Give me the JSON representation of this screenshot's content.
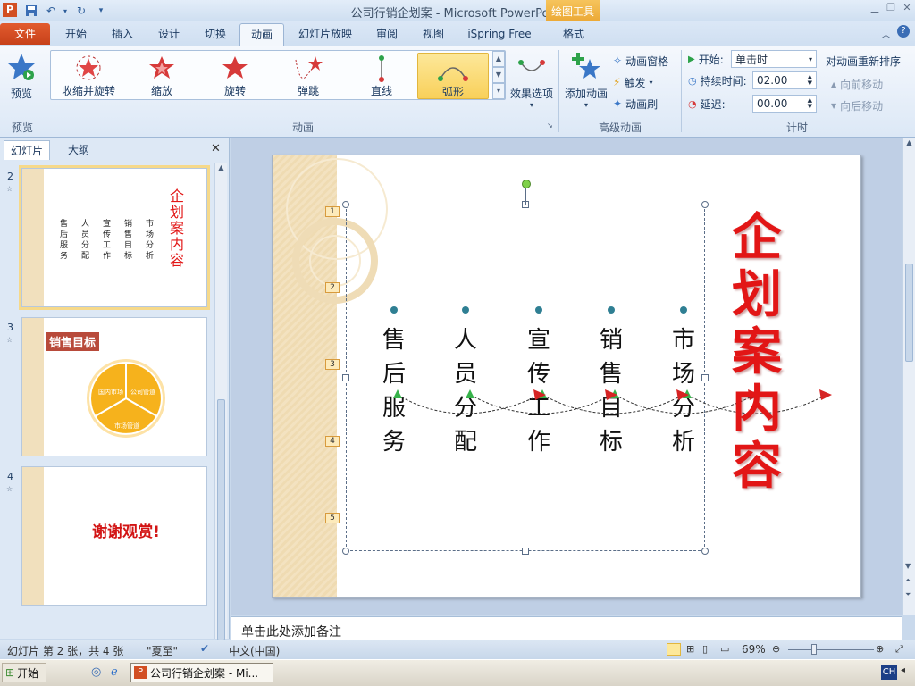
{
  "window": {
    "title": "公司行销企划案 - Microsoft PowerPoint",
    "context_tab": "绘图工具"
  },
  "tabs": {
    "file": "文件",
    "items": [
      "开始",
      "插入",
      "设计",
      "切换",
      "动画",
      "幻灯片放映",
      "审阅",
      "视图",
      "iSpring Free",
      "格式"
    ],
    "active": "动画"
  },
  "ribbon": {
    "preview": {
      "label": "预览",
      "group": "预览"
    },
    "animations": {
      "items": [
        "收缩并旋转",
        "缩放",
        "旋转",
        "弹跳",
        "直线",
        "弧形"
      ],
      "selected": "弧形",
      "effect_options": "效果选项",
      "group": "动画"
    },
    "advanced": {
      "add_animation": "添加动画",
      "animation_pane": "动画窗格",
      "trigger": "触发",
      "animation_painter": "动画刷",
      "group": "高级动画"
    },
    "timing": {
      "start_label": "开始:",
      "start_value": "单击时",
      "duration_label": "持续时间:",
      "duration_value": "02.00",
      "delay_label": "延迟:",
      "delay_value": "00.00",
      "reorder_title": "对动画重新排序",
      "move_earlier": "向前移动",
      "move_later": "向后移动",
      "group": "计时"
    }
  },
  "left_panel": {
    "tab_slides": "幻灯片",
    "tab_outline": "大纲",
    "thumbs": [
      {
        "num": "2",
        "title": "企划案内容",
        "cols": [
          "售后服务",
          "人员分配",
          "宣传工作",
          "销售目标",
          "市场分析"
        ]
      },
      {
        "num": "3",
        "title": "销售目标",
        "segments": [
          "国内市场",
          "公司管道",
          "市场管道"
        ]
      },
      {
        "num": "4",
        "title": "谢谢观赏!"
      }
    ]
  },
  "slide": {
    "title": "企划案内容",
    "columns": [
      "售后服务",
      "人员分配",
      "宣传工作",
      "销售目标",
      "市场分析"
    ],
    "anim_tags": [
      "1",
      "2",
      "3",
      "4",
      "5"
    ]
  },
  "notes": {
    "placeholder": "单击此处添加备注"
  },
  "status": {
    "slide_info": "幻灯片 第 2 张，共 4 张",
    "theme": "\"夏至\"",
    "language": "中文(中国)",
    "zoom": "69%"
  },
  "taskbar": {
    "start": "开始",
    "task": "公司行销企划案 - Mi...",
    "lang": "CH"
  },
  "colors": {
    "file_tab": "#d24f22",
    "slide_title": "#e21616",
    "selected_anim": "#f8d05a"
  }
}
